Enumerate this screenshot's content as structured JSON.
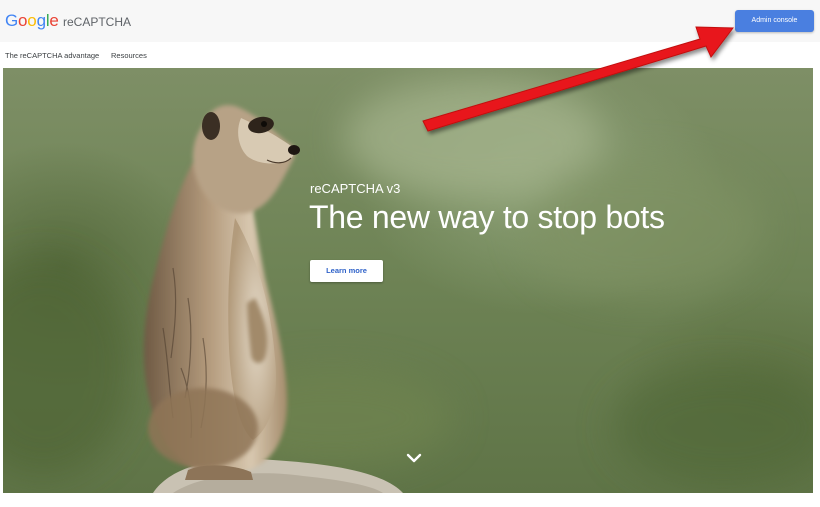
{
  "header": {
    "logo_letters": [
      "G",
      "o",
      "o",
      "g",
      "l",
      "e"
    ],
    "logo_colors": [
      "#4285f4",
      "#ea4335",
      "#fbbc05",
      "#4285f4",
      "#34a853",
      "#ea4335"
    ],
    "product_name": "reCAPTCHA",
    "admin_button_label": "Admin console",
    "admin_button_color": "#4a7fe0"
  },
  "subnav": {
    "items": [
      {
        "label": "The reCAPTCHA advantage"
      },
      {
        "label": "Resources"
      }
    ]
  },
  "hero": {
    "eyebrow": "reCAPTCHA v3",
    "title": "The new way to stop bots",
    "cta_label": "Learn more",
    "scroll_icon": "chevron-down-icon",
    "image_subject": "meerkat"
  },
  "annotation": {
    "arrow_color": "#e8191a",
    "points_to": "admin-console-button"
  }
}
